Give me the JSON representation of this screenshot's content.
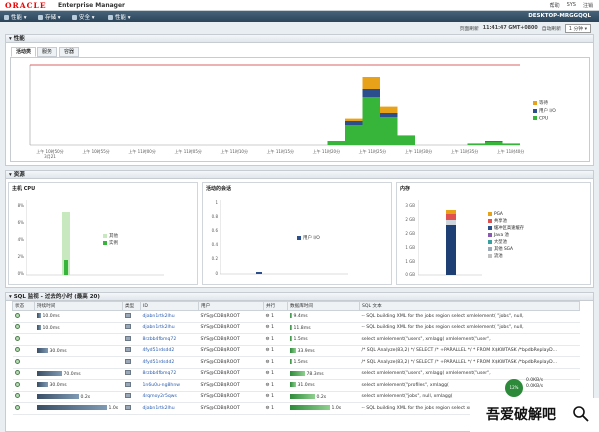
{
  "header": {
    "logo_text": "ORACLE",
    "product": "Enterprise Manager",
    "top_links": [
      "帮助",
      "SYS",
      "注销"
    ],
    "host_label": "DESKTOP-MRGGQQL"
  },
  "nav": {
    "menus": [
      "性能",
      "存储",
      "安全",
      "性能"
    ]
  },
  "status_bar": {
    "page_refreshed_label": "页面刷新",
    "refresh_time": "11:41:47 GMT+0800",
    "auto_refresh_label": "自动刷新",
    "auto_refresh_value": "1 分钟"
  },
  "performance": {
    "section_title": "性能",
    "tabs": [
      "活动类",
      "服务",
      "容器"
    ],
    "x_ticks": [
      "上午 10时50分\n3月21",
      "上午 10时55分",
      "上午 11时00分",
      "上午 11时05分",
      "上午 11时10分",
      "上午 11时15分",
      "上午 11时20分",
      "上午 11时25分",
      "上午 11时30分",
      "上午 11时35分",
      "上午 11时40分"
    ],
    "legend": [
      {
        "label": "等待",
        "color": "#e8a21a"
      },
      {
        "label": "用户 I/O",
        "color": "#2b4f8c"
      },
      {
        "label": "CPU",
        "color": "#37b43a"
      }
    ]
  },
  "resources": {
    "section_title": "资源",
    "host_cpu": {
      "title": "主机 CPU",
      "y_ticks": [
        "8%",
        "6%",
        "4%",
        "2%",
        "0%"
      ],
      "legend": [
        {
          "label": "其他",
          "color": "#c8e8c0"
        },
        {
          "label": "实例",
          "color": "#37b43a"
        }
      ]
    },
    "active_sessions": {
      "title": "活动的会话",
      "y_ticks": [
        "1",
        "0.8",
        "0.6",
        "0.4",
        "0.2",
        "0"
      ],
      "legend": [
        {
          "label": "用户 I/O",
          "color": "#2b4f8c"
        }
      ]
    },
    "memory": {
      "title": "内存",
      "y_ticks": [
        "3 GB",
        "2 GB",
        "2 GB",
        "1 GB",
        "1 GB",
        "0 GB"
      ],
      "legend": [
        {
          "label": "PGA",
          "color": "#e8a21a"
        },
        {
          "label": "共享池",
          "color": "#e05050"
        },
        {
          "label": "缓冲区高速缓存",
          "color": "#2b4f8c"
        },
        {
          "label": "Java 池",
          "color": "#8a5ab0"
        },
        {
          "label": "大型池",
          "color": "#39a0a0"
        },
        {
          "label": "其他 SGA",
          "color": "#9aa8b8"
        },
        {
          "label": "流池",
          "color": "#c0c0c0"
        }
      ]
    }
  },
  "sql_monitor": {
    "section_title": "SQL 监视 - 过去的小时 (最高 20)",
    "columns": [
      "状态",
      "持续时间",
      "类型",
      "ID",
      "用户",
      "并行",
      "数据库时间",
      "SQL 文本"
    ],
    "rows": [
      {
        "duration": "10.0ms",
        "id": "djabn1rtk2lhu",
        "user": "SYS@CDB$ROOT",
        "parallel": "1",
        "db_time": "9.4ms",
        "sql": "-- SQL building XML for the jobs region    select    xmlelement(    \"jobs\",    null,"
      },
      {
        "duration": "10.0ms",
        "id": "djabn1rtk2lhu",
        "user": "SYS@CDB$ROOT",
        "parallel": "1",
        "db_time": "11.8ms",
        "sql": "-- SQL building XML for the jobs region    select    xmlelement(    \"jobs\",    null,"
      },
      {
        "duration": "",
        "id": "8rzbb4fbmq72",
        "user": "SYS@CDB$ROOT",
        "parallel": "1",
        "db_time": "1.5ms",
        "sql": "select    xmlelement(\"users\",    xmlagg(    xmlelement(\"user\","
      },
      {
        "duration": "30.0ms",
        "id": "4fyd51rdsdd2",
        "user": "SYS@CDB$ROOT",
        "parallel": "1",
        "db_time": "33.9ms",
        "sql": "/* SQL Analyze(83,2) */ SELECT /* +PARALLEL */ * FROM X$KWTASK /*bpdbReplayD..."
      },
      {
        "duration": "",
        "id": "4fyd51rdsdd2",
        "user": "SYS@CDB$ROOT",
        "parallel": "1",
        "db_time": "1.5ms",
        "sql": "/* SQL Analyze(83,2) */ SELECT /* +PARALLEL */ * FROM X$KWTASK /*bpdbReplayD..."
      },
      {
        "duration": "70.0ms",
        "id": "8rzbb4fbmq72",
        "user": "SYS@CDB$ROOT",
        "parallel": "1",
        "db_time": "78.3ms",
        "sql": "select    xmlelement(\"users\",    xmlagg(    xmlelement(\"user\","
      },
      {
        "duration": "30.0ms",
        "id": "1n6u0u-ng8hnw",
        "user": "SYS@CDB$ROOT",
        "parallel": "1",
        "db_time": "31.0ms",
        "sql": "select xmlelement(\"profiles\",    xmlagg(     "
      },
      {
        "duration": "0.2s",
        "id": "4rqmoy2r5qws",
        "user": "SYS@CDB$ROOT",
        "parallel": "1",
        "db_time": "0.2s",
        "sql": "select    xmlelement(\"jobs\",    null,    xmlagg("
      },
      {
        "duration": "1.0s",
        "id": "djabn1rtk2lhu",
        "user": "SYS@CDB$ROOT",
        "parallel": "1",
        "db_time": "1.0s",
        "sql": "-- SQL building XML for the jobs region    select    xmlelement("
      }
    ],
    "duration_fraction": [
      0.05,
      0.05,
      0,
      0.15,
      0,
      0.35,
      0.15,
      0.6,
      1.0
    ],
    "db_time_fraction": [
      0.04,
      0.05,
      0.01,
      0.16,
      0.01,
      0.38,
      0.15,
      0.62,
      1.0
    ]
  },
  "performance_chart": {
    "cpu": [
      0,
      0,
      0,
      0,
      0,
      0,
      0,
      0,
      0,
      0,
      0,
      0,
      0,
      0,
      0,
      0,
      0,
      0.05,
      0.25,
      0.6,
      0.35,
      0.12,
      0,
      0,
      0,
      0.02,
      0.04,
      0.02
    ],
    "user_io": [
      0,
      0,
      0,
      0,
      0,
      0,
      0,
      0,
      0,
      0,
      0,
      0,
      0,
      0,
      0,
      0,
      0,
      0,
      0.05,
      0.1,
      0.05,
      0,
      0,
      0,
      0,
      0,
      0.01,
      0
    ],
    "wait": [
      0,
      0,
      0,
      0,
      0,
      0,
      0,
      0,
      0,
      0,
      0,
      0,
      0,
      0,
      0,
      0,
      0,
      0,
      0.03,
      0.15,
      0.08,
      0,
      0,
      0,
      0,
      0,
      0,
      0
    ],
    "cpu_limit": 1
  },
  "watermark": {
    "text": "吾爱破解吧",
    "badge": "12%",
    "mini_lines": [
      "0.0KB/s",
      "0.0KB/s"
    ]
  }
}
